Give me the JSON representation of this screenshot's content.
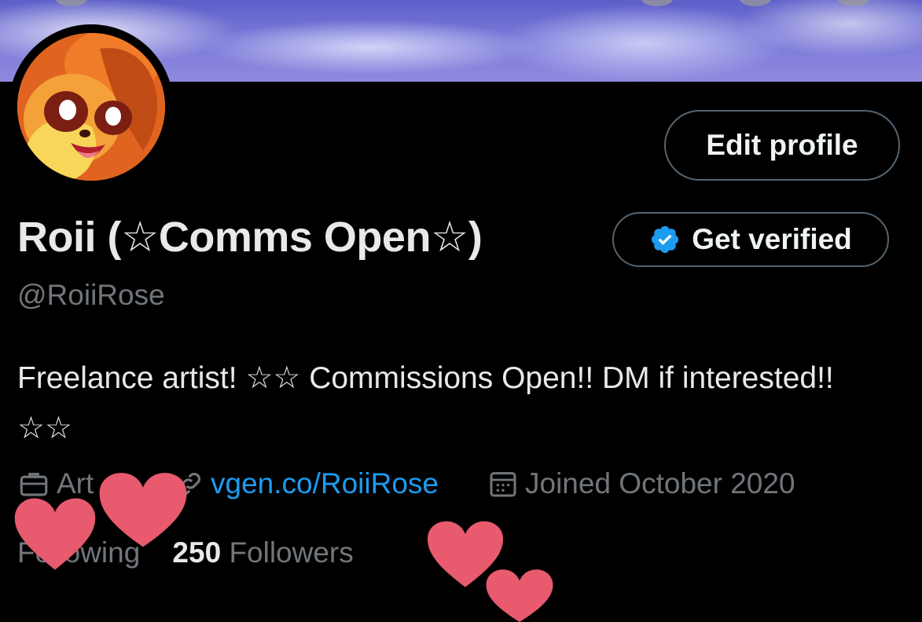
{
  "profile": {
    "display_name": "Roii (☆Comms Open☆)",
    "handle": "@RoiiRose",
    "bio": "Freelance artist! ☆☆ Commissions Open!! DM if interested!! ☆☆",
    "category": "Art",
    "website": "vgen.co/RoiiRose",
    "joined": "Joined October 2020",
    "following_label": "Following",
    "followers_count": "250",
    "followers_label": "Followers"
  },
  "buttons": {
    "edit_profile": "Edit profile",
    "get_verified": "Get verified"
  },
  "icons": {
    "category": "briefcase-icon",
    "website": "link-icon",
    "joined": "calendar-icon",
    "verified": "verified-badge-icon"
  },
  "colors": {
    "background": "#000000",
    "link": "#1d9bf0",
    "muted_text": "#71767b",
    "heart_sticker": "#e85a6e",
    "verified_badge": "#1d9bf0"
  }
}
